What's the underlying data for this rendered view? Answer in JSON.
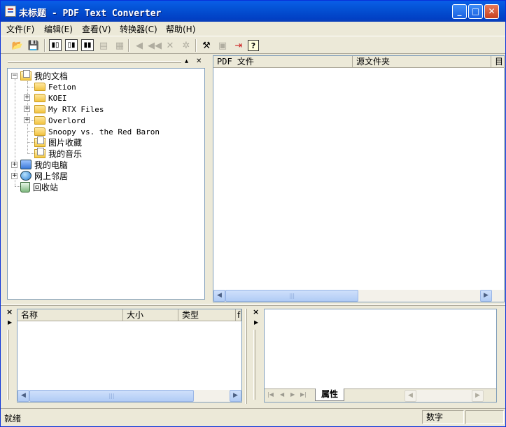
{
  "window": {
    "title": "未标题 - PDF Text Converter",
    "controls": {
      "minimize": "_",
      "maximize": "□",
      "close": "✕"
    }
  },
  "menu": [
    "文件(F)",
    "编辑(E)",
    "查看(V)",
    "转换器(C)",
    "帮助(H)"
  ],
  "toolbar": {
    "icons": [
      "open-folder-icon",
      "save-icon",
      "view-mode-1-icon",
      "view-mode-2-icon",
      "view-mode-3-icon",
      "add-file-icon",
      "add-folder-icon",
      "move-first-icon",
      "move-prev-icon",
      "delete-icon",
      "settings-gear-icon",
      "convert-hammer-icon",
      "options-icon",
      "exit-icon",
      "help-icon"
    ]
  },
  "tree": {
    "root": "我的文档",
    "children": [
      "Fetion",
      "KOEI",
      "My RTX Files",
      "Overlord",
      "Snoopy vs. the Red Baron",
      "图片收藏",
      "我的音乐"
    ],
    "top_level": [
      "我的电脑",
      "网上邻居",
      "回收站"
    ],
    "pane_buttons": {
      "pin": "▴",
      "close": "✕"
    }
  },
  "file_list": {
    "columns": [
      "PDF 文件",
      "源文件夹",
      "目"
    ]
  },
  "bottom_left": {
    "columns": [
      "名称",
      "大小",
      "类型",
      "f"
    ]
  },
  "bottom_right": {
    "tab_label": "属性"
  },
  "status": {
    "text": "就绪",
    "num_label": "数字"
  }
}
